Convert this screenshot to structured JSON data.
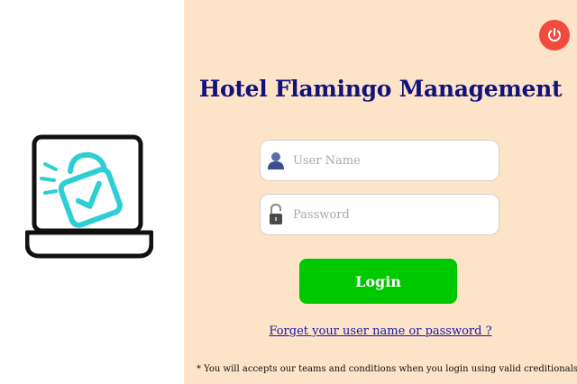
{
  "window": {
    "title": "Hotel Flamingo Management"
  },
  "illustration": {
    "icon": "laptop-lock-icon",
    "accent_color": "#2ecfd4",
    "outline_color": "#111111"
  },
  "header": {
    "power_icon": "power-icon",
    "power_color": "#f14b3e"
  },
  "login_form": {
    "username": {
      "icon": "user-icon",
      "placeholder": "User Name",
      "value": ""
    },
    "password": {
      "icon": "padlock-icon",
      "placeholder": "Password",
      "value": ""
    },
    "submit_label": "Login",
    "submit_color": "#00c800",
    "forgot_link": "Forget your user name or password ?"
  },
  "footer": {
    "terms_note": "* You will accepts our teams and conditions when you login using valid creditionals"
  },
  "colors": {
    "panel_background": "#fde3c7",
    "title_color": "#12127a",
    "link_color": "#1a1aa6"
  }
}
